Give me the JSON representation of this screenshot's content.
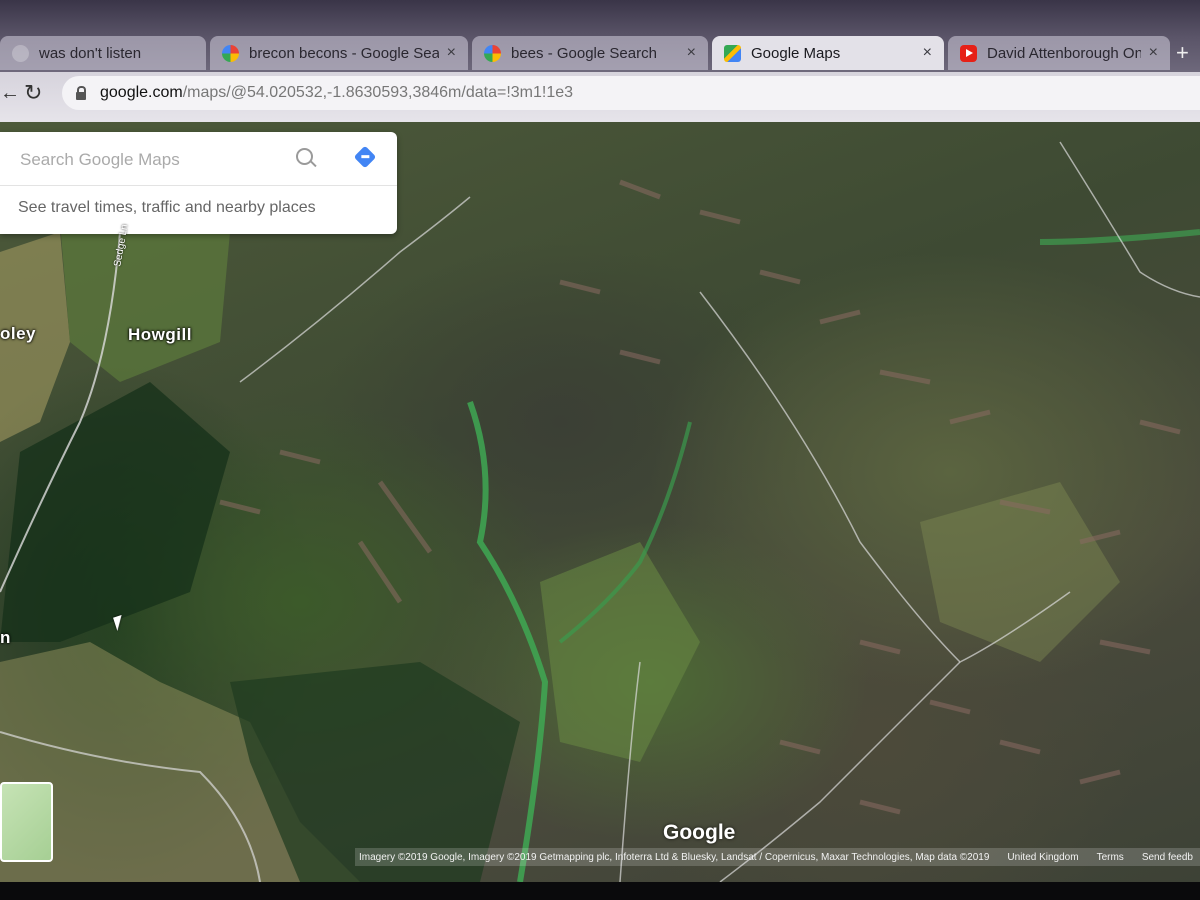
{
  "browser": {
    "tabs": [
      {
        "title": "was don't listen",
        "icon": "partial-tab-icon",
        "active": false
      },
      {
        "title": "brecon becons - Google Search",
        "icon": "google-icon",
        "active": false
      },
      {
        "title": "bees - Google Search",
        "icon": "google-icon",
        "active": false
      },
      {
        "title": "Google Maps",
        "icon": "google-maps-icon",
        "active": true
      },
      {
        "title": "David Attenborough On Dyna",
        "icon": "youtube-icon",
        "active": false
      }
    ],
    "close_glyph": "×",
    "newtab_glyph": "+",
    "back_glyph": "←",
    "reload_glyph": "↻",
    "url_host": "google.com",
    "url_path": "/maps/@54.020532,-1.8630593,3846m/data=!3m1!1e3"
  },
  "search": {
    "placeholder": "Search Google Maps",
    "travel_link": "See travel times, traffic and nearby places"
  },
  "map": {
    "labels": {
      "howgill": "Howgill",
      "oley": "oley",
      "road": "Sedge Ln",
      "edge": "n"
    },
    "logo": "Google",
    "attribution": "Imagery ©2019 Google, Imagery ©2019 Getmapping plc, Infoterra Ltd & Bluesky, Landsat / Copernicus, Maxar Technologies, Map data ©2019",
    "region": "United Kingdom",
    "terms": "Terms",
    "feedback": "Send feedb"
  },
  "colors": {
    "accent": "#4285f4",
    "active_tab": "#e3e1e8"
  }
}
